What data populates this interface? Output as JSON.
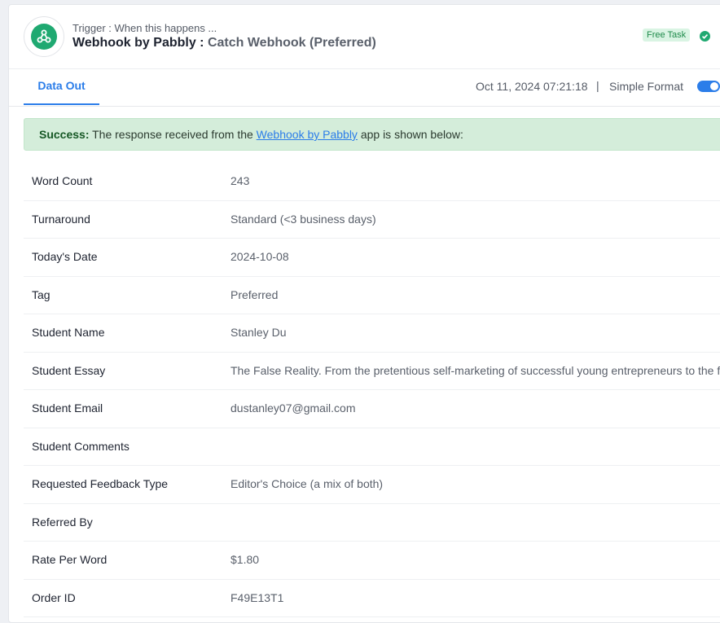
{
  "header": {
    "trigger_label": "Trigger : When this happens ...",
    "app_name": "Webhook by Pabbly :",
    "event_name": "Catch Webhook (Preferred)",
    "badge": "Free Task",
    "status_icon": "check-circle-icon",
    "logo_icon": "webhook-icon"
  },
  "tabs": {
    "active_label": "Data Out",
    "timestamp": "Oct 11, 2024 07:21:18",
    "separator": "|",
    "format_label": "Simple Format",
    "simple_format_on": true
  },
  "banner": {
    "prefix": "Success:",
    "text_before": "The response received from the",
    "link": "Webhook by Pabbly",
    "text_after": "app is shown below:"
  },
  "colors": {
    "accent": "#2b7de9",
    "brand_green": "#1fa971",
    "success_bg": "#d4edda"
  },
  "rows": [
    {
      "key": "Word Count",
      "value": "243"
    },
    {
      "key": "Turnaround",
      "value": "Standard (<3 business days)"
    },
    {
      "key": "Today's Date",
      "value": "2024-10-08"
    },
    {
      "key": "Tag",
      "value": "Preferred"
    },
    {
      "key": "Student Name",
      "value": "Stanley Du"
    },
    {
      "key": "Student Essay",
      "value": "The False Reality. From the pretentious self-marketing of successful young entrepreneurs to the fal"
    },
    {
      "key": "Student Email",
      "value": "dustanley07@gmail.com"
    },
    {
      "key": "Student Comments",
      "value": ""
    },
    {
      "key": "Requested Feedback Type",
      "value": "Editor's Choice (a mix of both)"
    },
    {
      "key": "Referred By",
      "value": ""
    },
    {
      "key": "Rate Per Word",
      "value": "$1.80"
    },
    {
      "key": "Order ID",
      "value": "F49E13T1"
    }
  ]
}
